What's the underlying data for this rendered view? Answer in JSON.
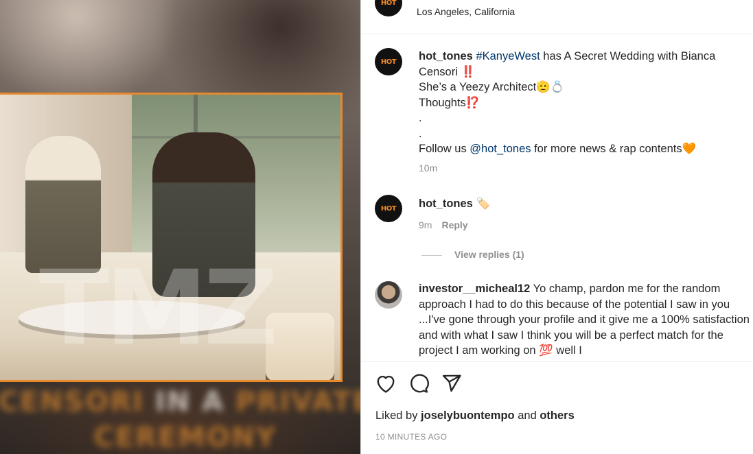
{
  "post": {
    "location": "Los Angeles, California",
    "brand_color": "#f08a2b"
  },
  "media": {
    "watermark": "TMZ",
    "caption_line1_a": "CENSORI",
    "caption_line1_b": "IN A",
    "caption_line1_c": "PRIVATE",
    "caption_line2": "CEREMONY"
  },
  "caption": {
    "username": "hot_tones",
    "hashtag": "#KanyeWest",
    "text_1": " has A Secret Wedding with Bianca Censori ‼️",
    "text_2": "She’s a Yeezy Architect",
    "emoji_2": "🫡💍",
    "text_3": "Thoughts⁉️",
    "dot_1": ".",
    "dot_2": ".",
    "follow_prefix": "Follow us ",
    "mention": "@hot_tones",
    "follow_suffix": " for more news & rap contents",
    "follow_emoji": "🧡",
    "time": "10m"
  },
  "comments": [
    {
      "username": "hot_tones",
      "text": "🏷️",
      "time": "9m",
      "reply_label": "Reply",
      "view_replies": "View replies (1)"
    },
    {
      "username": "investor__micheal12",
      "text": " Yo champ, pardon me for the random approach I had to do this because of the potential I saw in you ...I've gone through your profile and it give me a 100% satisfaction and with what I saw I think you will be a perfect match for the project I am working on 💯 well I"
    }
  ],
  "actions": {
    "like_icon": "heart-icon",
    "comment_icon": "comment-icon",
    "share_icon": "share-icon"
  },
  "likes": {
    "prefix": "Liked by ",
    "user": "joselybuontempo",
    "middle": " and ",
    "others": "others"
  },
  "timestamp": "10 MINUTES AGO"
}
